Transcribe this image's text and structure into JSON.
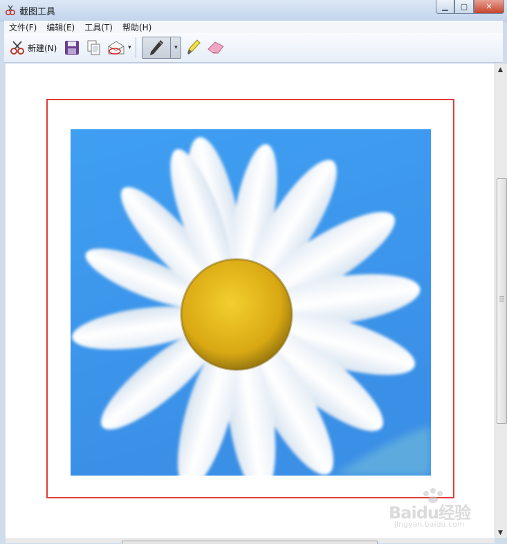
{
  "window": {
    "title": "截图工具",
    "minimize": "▁",
    "maximize": "▢",
    "close": "✕"
  },
  "menu": [
    "文件(F)",
    "编辑(E)",
    "工具(T)",
    "帮助(H)"
  ],
  "toolbar": {
    "new_label": "新建(N)",
    "dropdown_glyph": "▾"
  },
  "scrollbar": {
    "up": "▲",
    "down": "▼"
  },
  "watermark": {
    "brand": "Baidu经验",
    "site": "jingyan.baidu.com"
  },
  "colors": {
    "selection_border": "#e23b3b",
    "sky": "#3a9df0",
    "flower_center": "#e2b419"
  }
}
